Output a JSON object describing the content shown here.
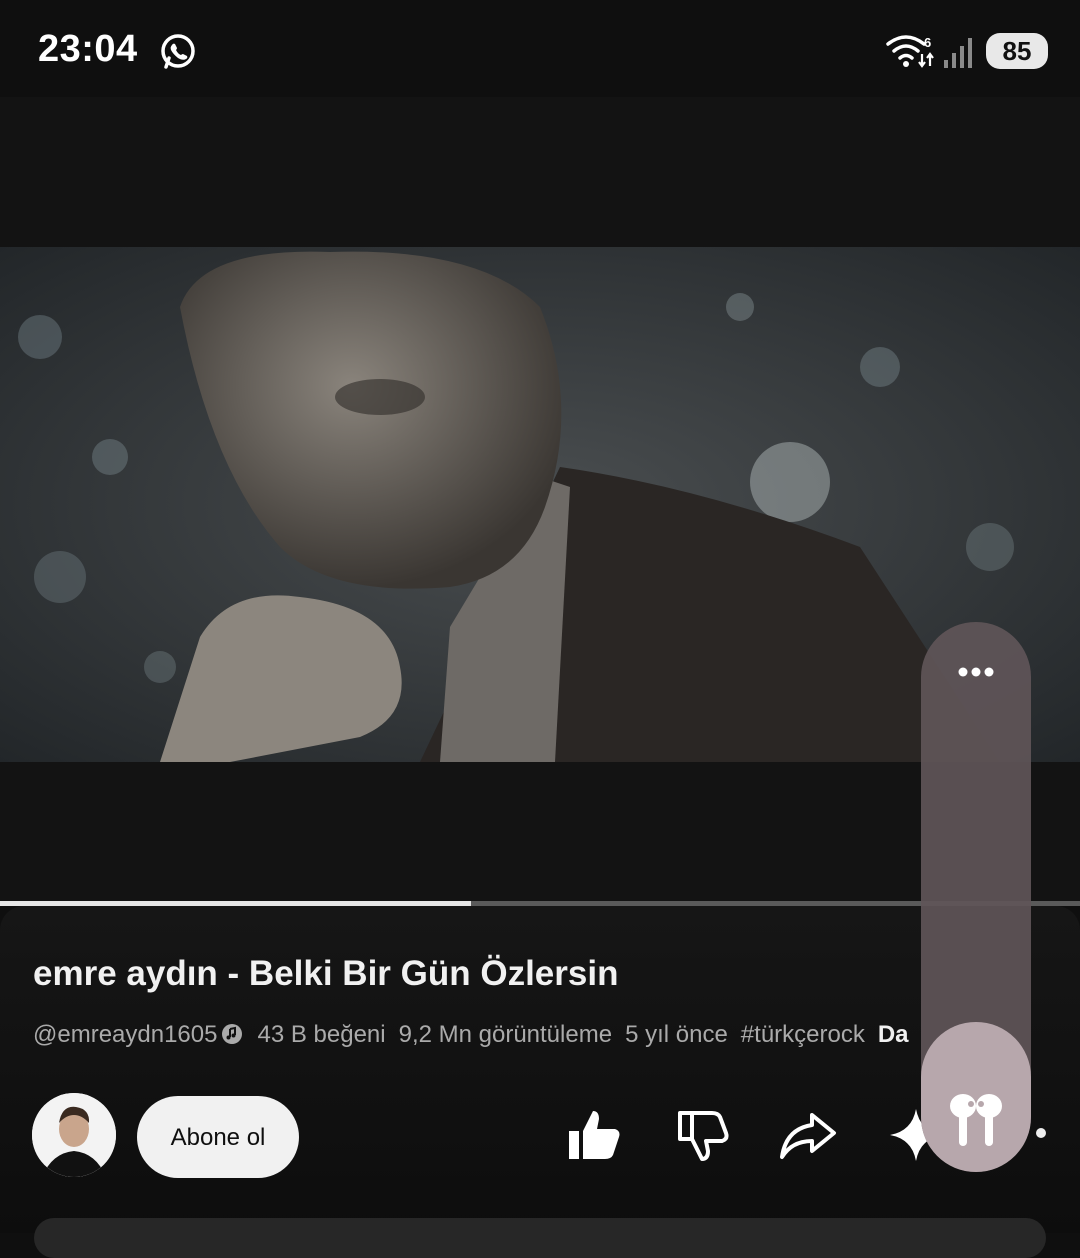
{
  "status_bar": {
    "time": "23:04",
    "notification_icon": "whatsapp-icon",
    "wifi_badge": "6",
    "battery_level": "85"
  },
  "player": {
    "progress": 0.436
  },
  "video": {
    "title": "emre aydın - Belki Bir Gün Özlersin",
    "channel_handle": "@emreaydn1605",
    "likes_text": "43 B beğeni",
    "views_text": "9,2 Mn görüntüleme",
    "age_text": "5 yıl önce",
    "hashtag": "#türkçerock",
    "more_text": "Da"
  },
  "actions": {
    "subscribe_label": "Abone ol",
    "icons": [
      "like-icon",
      "dislike-icon",
      "share-icon",
      "sparkle-icon"
    ]
  },
  "colors": {
    "background": "#0f0f0f",
    "subscribe_bg": "#f1f1f1",
    "panel": "#5f5558",
    "panel_accent": "#b7a7ac"
  }
}
